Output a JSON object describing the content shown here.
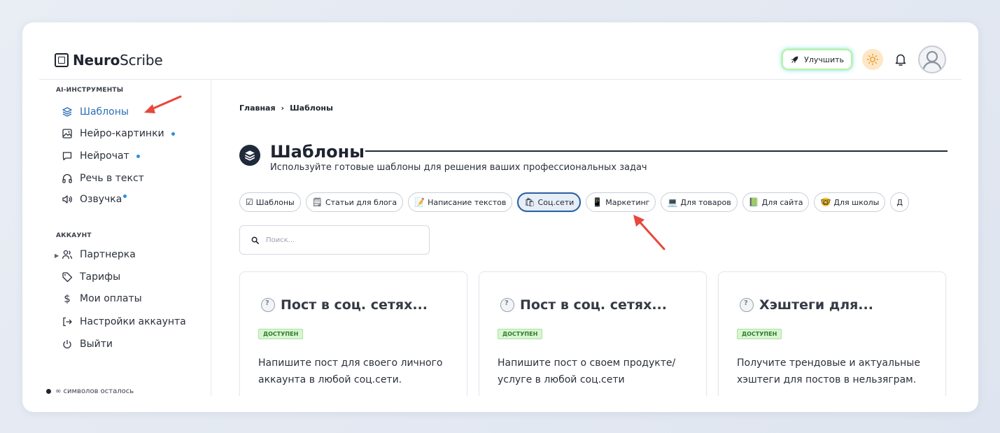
{
  "brand": {
    "bold": "Neuro",
    "light": "Scribe"
  },
  "header": {
    "upgrade_label": "Улучшить"
  },
  "sidebar": {
    "ai_section": "AI-ИНСТРУМЕНТЫ",
    "ai_items": [
      {
        "label": "Шаблоны",
        "icon": "layers-icon",
        "active": true
      },
      {
        "label": "Нейро-картинки",
        "icon": "image-icon",
        "dot": true
      },
      {
        "label": "Нейрочат",
        "icon": "chat-icon",
        "dot": true
      },
      {
        "label": "Речь в текст",
        "icon": "headphones-icon"
      },
      {
        "label": "Озвучка",
        "icon": "speaker-icon",
        "dot": true
      }
    ],
    "account_section": "АККАУНТ",
    "account_items": [
      {
        "label": "Партнерка",
        "icon": "users-icon"
      },
      {
        "label": "Тарифы",
        "icon": "tag-icon"
      },
      {
        "label": "Мои оплаты",
        "icon": "dollar-icon"
      },
      {
        "label": "Настройки аккаунта",
        "icon": "login-icon"
      },
      {
        "label": "Выйти",
        "icon": "power-icon"
      }
    ],
    "credits_text": "∞ символов осталось"
  },
  "breadcrumb": {
    "home": "Главная",
    "sep": "›",
    "current": "Шаблоны"
  },
  "page": {
    "title": "Шаблоны",
    "subtitle": "Используйте готовые шаблоны для решения ваших профессиональных задач"
  },
  "chips": [
    {
      "emoji": "☑",
      "label": "Шаблоны"
    },
    {
      "emoji": "🗒",
      "label": "Статьи для блога"
    },
    {
      "emoji": "📝",
      "label": "Написание текстов"
    },
    {
      "emoji": "🛍",
      "label": "Соц.сети",
      "active": true
    },
    {
      "emoji": "📱",
      "label": "Маркетинг"
    },
    {
      "emoji": "💻",
      "label": "Для товаров"
    },
    {
      "emoji": "📗",
      "label": "Для сайта"
    },
    {
      "emoji": "🤓",
      "label": "Для школы"
    },
    {
      "emoji": "",
      "label": "Д"
    }
  ],
  "search": {
    "placeholder": "Поиск..."
  },
  "cards": [
    {
      "title": "Пост в соц. сетях...",
      "badge": "ДОСТУПЕН",
      "desc": "Напишите пост для своего личного аккаунта в любой соц.сети."
    },
    {
      "title": "Пост в соц. сетях...",
      "badge": "ДОСТУПЕН",
      "desc": "Напишите пост о своем продукте/ услуге в любой соц.сети"
    },
    {
      "title": "Хэштеги для...",
      "badge": "ДОСТУПЕН",
      "desc": "Получите трендовые и актуальные хэштеги для постов в нельзяграм."
    }
  ],
  "colors": {
    "accent": "#2a6fb8",
    "annotation_arrow": "#e8473c",
    "badge_bg": "#d8f5d2"
  }
}
